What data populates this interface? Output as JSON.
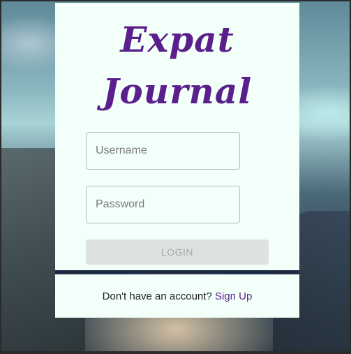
{
  "app": {
    "title_line1": "Expat",
    "title_line2": "Journal"
  },
  "login_form": {
    "username_placeholder": "Username",
    "password_placeholder": "Password",
    "login_label": "LOGIN"
  },
  "footer": {
    "prompt": "Don't have an account?",
    "signup_link": "Sign Up"
  },
  "colors": {
    "brand": "#5a1f8c",
    "card_background": "#f3fff9",
    "button_disabled": "#dde1e0"
  }
}
